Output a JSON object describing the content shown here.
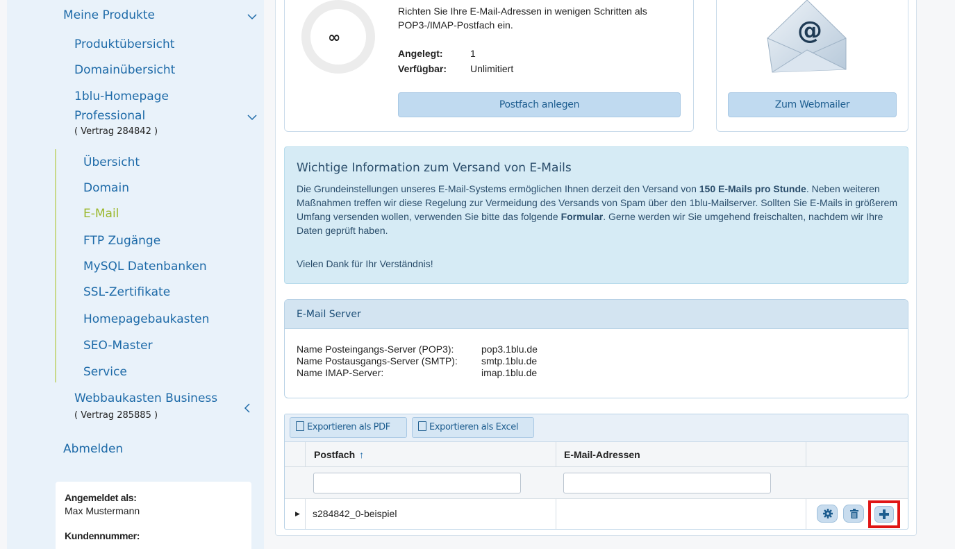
{
  "sidebar": {
    "meine_produkte": "Meine Produkte",
    "produktuebersicht": "Produktübersicht",
    "domainuebersicht": "Domainübersicht",
    "homepage_line1": "1blu-Homepage",
    "homepage_line2": "Professional",
    "homepage_contract": "( Vertrag 284842 )",
    "sub_items": [
      {
        "label": "Übersicht"
      },
      {
        "label": "Domain"
      },
      {
        "label": "E-Mail"
      },
      {
        "label": "FTP Zugänge"
      },
      {
        "label": "MySQL Datenbanken"
      },
      {
        "label": "SSL-Zertifikate"
      },
      {
        "label": "Homepagebaukasten"
      },
      {
        "label": "SEO-Master"
      },
      {
        "label": "Service"
      }
    ],
    "webbaukasten": "Webbaukasten Business",
    "webbaukasten_contract": "( Vertrag 285885 )",
    "abmelden": "Abmelden",
    "login": {
      "label": "Angemeldet als:",
      "user": "Max Mustermann",
      "kunden_label": "Kundennummer:"
    }
  },
  "postfach_card": {
    "ring_symbol": "∞",
    "description": "Richten Sie Ihre E-Mail-Adressen in wenigen Schritten als POP3-/IMAP-Postfach ein.",
    "angelegt_label": "Angelegt:",
    "angelegt_value": "1",
    "verfuegbar_label": "Verfügbar:",
    "verfuegbar_value": "Unlimitiert",
    "button": "Postfach anlegen"
  },
  "webmailer_card": {
    "icon": "mail-envelope-icon",
    "button": "Zum Webmailer"
  },
  "info": {
    "title": "Wichtige Information zum Versand von E-Mails",
    "text_part1": "Die Grundeinstellungen unseres E-Mail-Systems ermöglichen Ihnen derzeit den Versand von ",
    "text_bold1": "150 E-Mails pro Stunde",
    "text_part2": ". Neben weiteren Maßnahmen treffen wir diese Regelung zur Vermeidung des Versands von Spam über den 1blu-Mailserver. Sollten Sie E-Mails in größerem Umfang versenden wollen, verwenden Sie bitte das folgende ",
    "text_link": "Formular",
    "text_part3": ". Gerne werden wir Sie umgehend freischalten, nachdem wir Ihre Daten geprüft haben.",
    "thanks": "Vielen Dank für Ihr Verständnis!"
  },
  "server": {
    "title": "E-Mail Server",
    "rows": [
      {
        "label": "Name Posteingangs-Server (POP3):",
        "value": "pop3.1blu.de"
      },
      {
        "label": "Name Postausgangs-Server (SMTP):",
        "value": "smtp.1blu.de"
      },
      {
        "label": "Name IMAP-Server:",
        "value": "imap.1blu.de"
      }
    ]
  },
  "grid": {
    "export_pdf": "Exportieren als PDF",
    "export_excel": "Exportieren als Excel",
    "col_postfach": "Postfach",
    "sort_symbol": "↑",
    "col_email": "E-Mail-Adressen",
    "filter_postfach": "",
    "filter_email": "",
    "rows": [
      {
        "postfach": "s284842_0-beispiel",
        "email": ""
      }
    ]
  },
  "colors": {
    "link": "#1d6aa8",
    "active": "#9bb82d",
    "highlight": "#e01515"
  }
}
